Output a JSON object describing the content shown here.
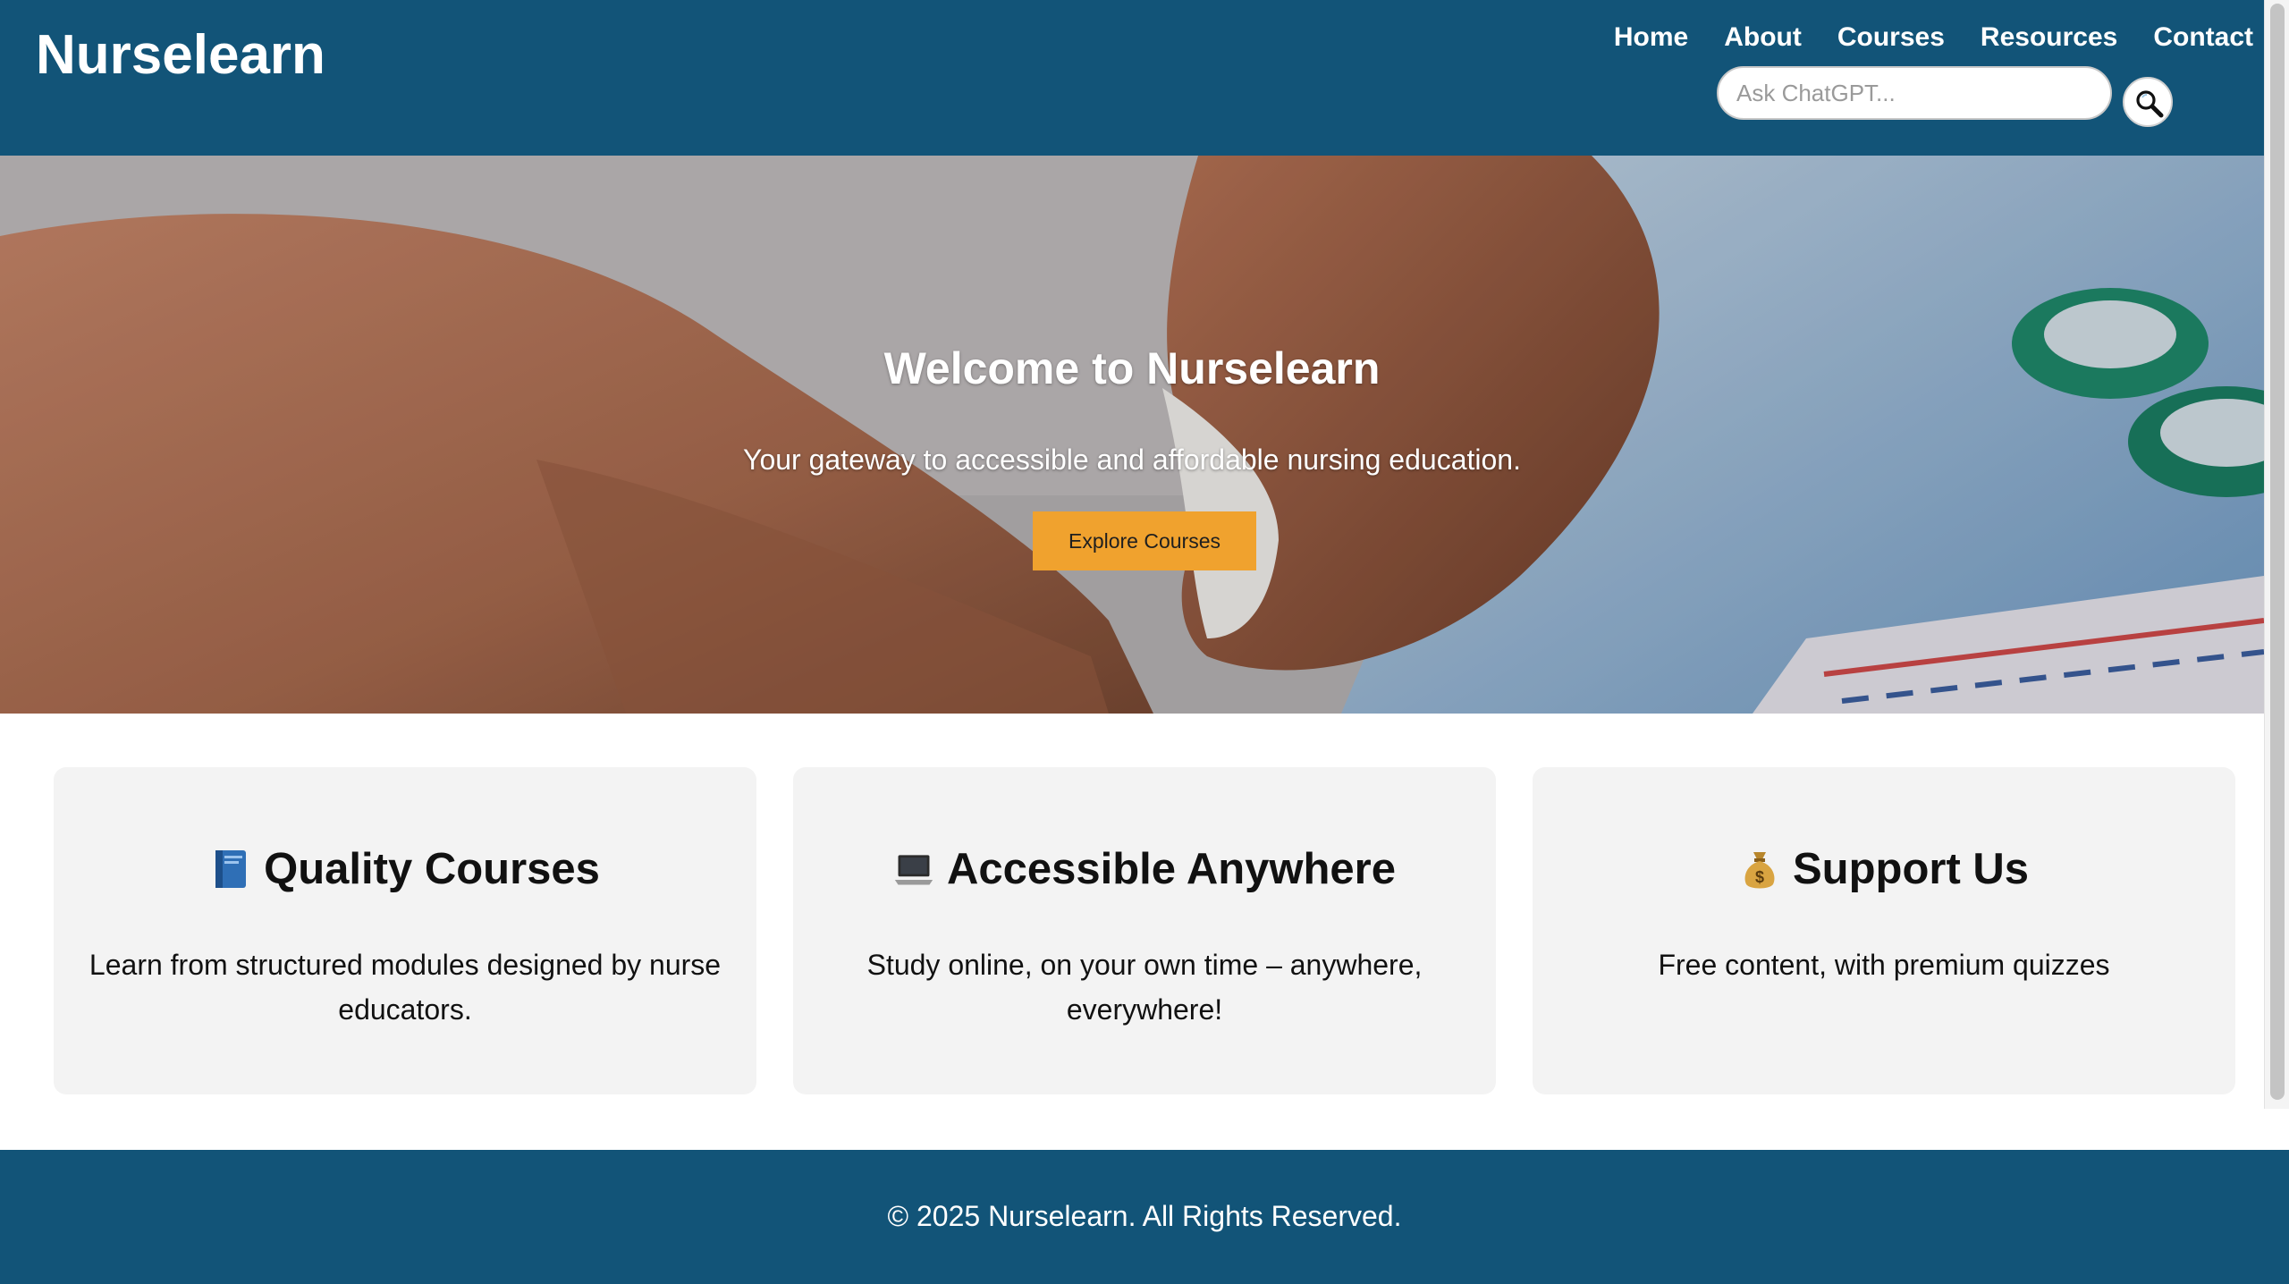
{
  "header": {
    "logo": "Nurselearn",
    "nav": [
      {
        "label": "Home"
      },
      {
        "label": "About"
      },
      {
        "label": "Courses"
      },
      {
        "label": "Resources"
      },
      {
        "label": "Contact"
      }
    ],
    "search": {
      "placeholder": "Ask ChatGPT...",
      "value": "",
      "button_icon": "search-icon"
    }
  },
  "hero": {
    "title": "Welcome to Nurselearn",
    "subtitle": "Your gateway to accessible and affordable nursing education.",
    "cta_label": "Explore Courses"
  },
  "features": [
    {
      "icon": "book-icon",
      "title": "Quality Courses",
      "text": "Learn from structured modules designed by nurse educators."
    },
    {
      "icon": "laptop-icon",
      "title": "Accessible Anywhere",
      "text": "Study online, on your own time – anywhere, everywhere!"
    },
    {
      "icon": "money-bag-icon",
      "title": "Support Us",
      "text": "Free content, with premium quizzes"
    }
  ],
  "footer": {
    "text": "© 2025 Nurselearn. All Rights Reserved."
  },
  "colors": {
    "primary": "#125478",
    "accent": "#f0a22e",
    "card_bg": "#f3f3f3"
  }
}
